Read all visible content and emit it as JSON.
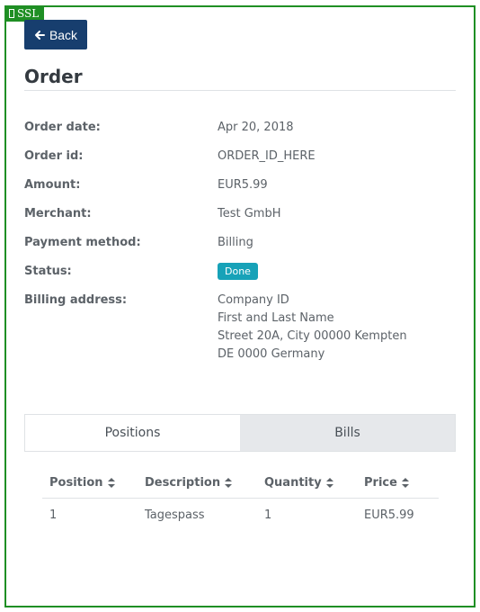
{
  "ssl_badge": {
    "label": "SSL"
  },
  "toolbar": {
    "back_label": "Back"
  },
  "page": {
    "title": "Order"
  },
  "details": [
    {
      "label": "Order date:",
      "value": "Apr 20, 2018"
    },
    {
      "label": "Order id:",
      "value": "ORDER_ID_HERE"
    },
    {
      "label": "Amount:",
      "value": "EUR5.99"
    },
    {
      "label": "Merchant:",
      "value": "Test GmbH"
    },
    {
      "label": "Payment method:",
      "value": "Billing"
    }
  ],
  "status": {
    "label": "Status:",
    "value": "Done",
    "color": "#17a2b8"
  },
  "billing": {
    "label": "Billing address:",
    "lines": [
      "Company ID",
      "First and Last Name",
      "Street 20A, City 00000 Kempten",
      "DE 0000 Germany"
    ]
  },
  "tabs": [
    {
      "label": "Positions",
      "active": true
    },
    {
      "label": "Bills",
      "active": false
    }
  ],
  "table": {
    "headers": [
      "Position",
      "Description",
      "Quantity",
      "Price"
    ],
    "rows": [
      [
        "1",
        "Tagespass",
        "1",
        "EUR5.99"
      ]
    ]
  },
  "colors": {
    "frame": "#1f8f24",
    "back_button": "#173e6e",
    "status_badge": "#17a2b8"
  }
}
